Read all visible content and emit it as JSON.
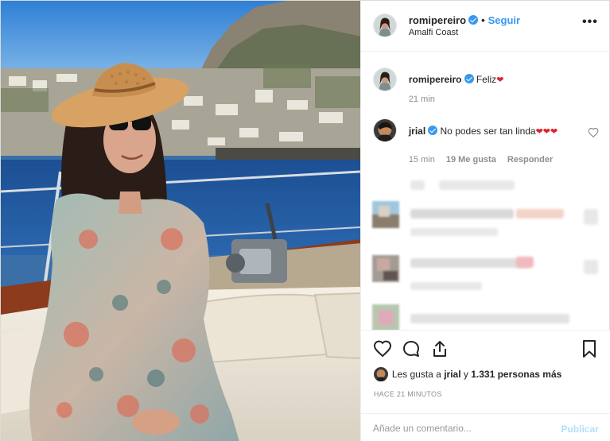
{
  "post": {
    "author": "romipereiro",
    "follow_label": "Seguir",
    "separator": "•",
    "location": "Amalfi Coast",
    "more_label": "•••"
  },
  "caption": {
    "user": "romipereiro",
    "text": "Feliz",
    "emoji": "❤",
    "time": "21 min"
  },
  "comments": [
    {
      "user": "jrial",
      "text": "No podes ser tan linda",
      "emoji": "❤❤❤",
      "time": "15 min",
      "likes": "19 Me gusta",
      "reply_label": "Responder"
    }
  ],
  "likes": {
    "prefix": "Les gusta a ",
    "user": "jrial",
    "middle": " y ",
    "count": "1.331 personas más"
  },
  "timestamp": "HACE 21 MINUTOS",
  "comment_input": {
    "placeholder": "Añade un comentario..."
  },
  "publish_label": "Publicar",
  "icons": {
    "verified": "verified-badge-icon",
    "like": "heart-icon",
    "comment": "comment-icon",
    "share": "share-icon",
    "save": "bookmark-icon",
    "more": "more-options-icon"
  },
  "colors": {
    "accent": "#3897f0",
    "heart": "#e0232f",
    "muted": "#8e8e8e",
    "publish_disabled": "#b2dffc"
  }
}
